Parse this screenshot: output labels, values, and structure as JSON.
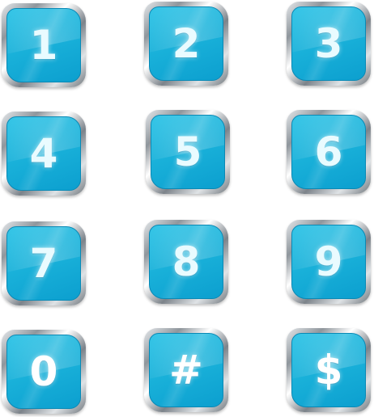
{
  "keypad": {
    "keys": [
      {
        "label": "1"
      },
      {
        "label": "2"
      },
      {
        "label": "3"
      },
      {
        "label": "4"
      },
      {
        "label": "5"
      },
      {
        "label": "6"
      },
      {
        "label": "7"
      },
      {
        "label": "8"
      },
      {
        "label": "9"
      },
      {
        "label": "0"
      },
      {
        "label": "#"
      },
      {
        "label": "$"
      }
    ]
  },
  "colors": {
    "face": "#1ab2da",
    "face_light": "#2cc3e6",
    "face_dark": "#0c9fcf",
    "bezel": "#9aa1a7",
    "label": "#e9fbff"
  }
}
